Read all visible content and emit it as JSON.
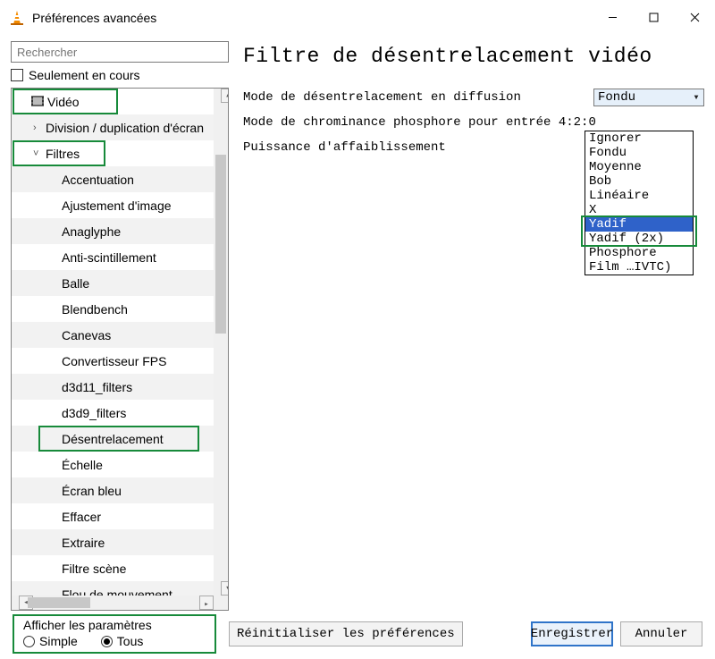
{
  "window": {
    "title": "Préférences avancées"
  },
  "search": {
    "placeholder": "Rechercher"
  },
  "only_running": {
    "label": "Seulement en cours",
    "checked": false
  },
  "tree": {
    "items": [
      {
        "label": "Vidéo",
        "depth": 0,
        "expanded": true,
        "icon": "film",
        "highlight": true
      },
      {
        "label": "Division / duplication d'écran",
        "depth": 1,
        "expanded": false,
        "arrow": ">"
      },
      {
        "label": "Filtres",
        "depth": 1,
        "expanded": true,
        "arrow": "v",
        "highlight": true
      },
      {
        "label": "Accentuation",
        "depth": 2
      },
      {
        "label": "Ajustement d'image",
        "depth": 2
      },
      {
        "label": "Anaglyphe",
        "depth": 2
      },
      {
        "label": "Anti-scintillement",
        "depth": 2
      },
      {
        "label": "Balle",
        "depth": 2
      },
      {
        "label": "Blendbench",
        "depth": 2
      },
      {
        "label": "Canevas",
        "depth": 2
      },
      {
        "label": "Convertisseur FPS",
        "depth": 2
      },
      {
        "label": "d3d11_filters",
        "depth": 2
      },
      {
        "label": "d3d9_filters",
        "depth": 2
      },
      {
        "label": "Désentrelacement",
        "depth": 2,
        "highlight": true
      },
      {
        "label": "Échelle",
        "depth": 2
      },
      {
        "label": "Écran bleu",
        "depth": 2
      },
      {
        "label": "Effacer",
        "depth": 2
      },
      {
        "label": "Extraire",
        "depth": 2
      },
      {
        "label": "Filtre scène",
        "depth": 2
      },
      {
        "label": "Flou de mouvement",
        "depth": 2
      }
    ]
  },
  "pane": {
    "title": "Filtre de désentrelacement vidéo",
    "rows": [
      {
        "label": "Mode de désentrelacement en diffusion",
        "value": "Fondu"
      },
      {
        "label": "Mode de chrominance phosphore pour entrée 4:2:0"
      },
      {
        "label": "Puissance d'affaiblissement"
      }
    ],
    "dropdown": {
      "options": [
        "Ignorer",
        "Fondu",
        "Moyenne",
        "Bob",
        "Linéaire",
        "X",
        "Yadif",
        "Yadif (2x)",
        "Phosphore",
        "Film …IVTC)"
      ],
      "selected_index": 6,
      "highlight_range": [
        6,
        7
      ]
    }
  },
  "params": {
    "legend": "Afficher les paramètres",
    "options": [
      "Simple",
      "Tous"
    ],
    "selected": "Tous"
  },
  "buttons": {
    "reset": "Réinitialiser les préférences",
    "save": "Enregistrer",
    "cancel": "Annuler"
  }
}
